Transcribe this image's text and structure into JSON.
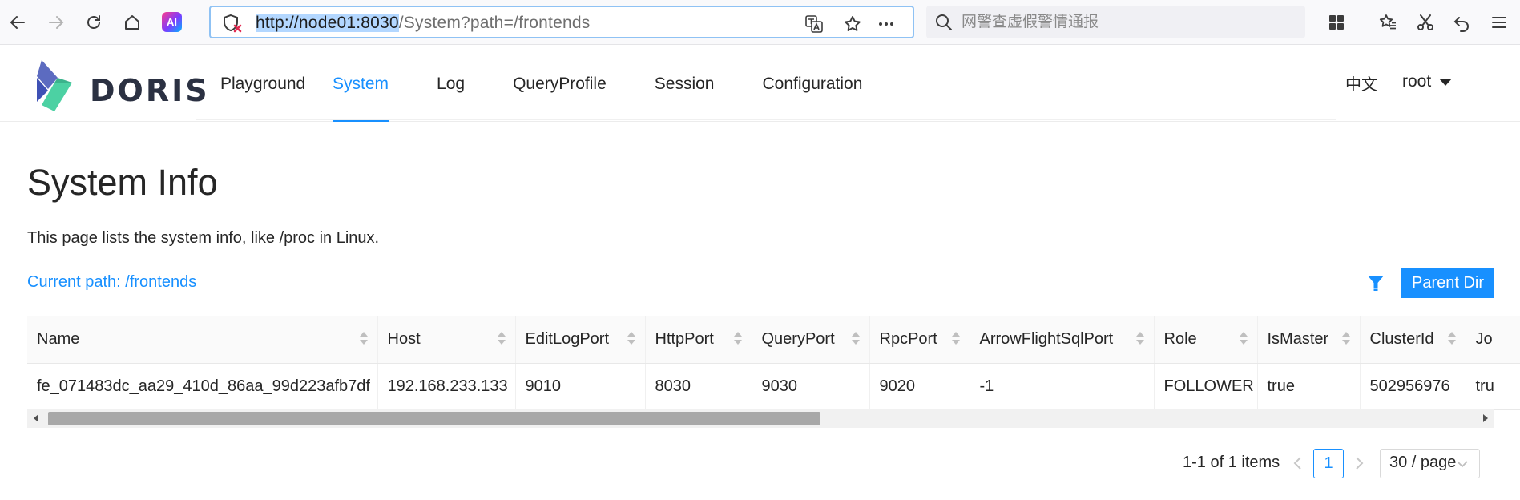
{
  "browser": {
    "url_host": "http://node01:8030",
    "url_path": "/System?path=/frontends",
    "search_placeholder": "网警查虚假警情通报",
    "ai_label": "AI"
  },
  "header": {
    "logo_text": "DORIS",
    "menu": [
      {
        "label": "Playground"
      },
      {
        "label": "System"
      },
      {
        "label": "Log"
      },
      {
        "label": "QueryProfile"
      },
      {
        "label": "Session"
      },
      {
        "label": "Configuration"
      }
    ],
    "active_menu": "System",
    "language": "中文",
    "user": "root"
  },
  "content": {
    "title": "System Info",
    "description": "This page lists the system info, like /proc in Linux.",
    "current_path": "Current path: /frontends",
    "parent_dir_label": "Parent Dir"
  },
  "table": {
    "columns": [
      "Name",
      "Host",
      "EditLogPort",
      "HttpPort",
      "QueryPort",
      "RpcPort",
      "ArrowFlightSqlPort",
      "Role",
      "IsMaster",
      "ClusterId",
      "Jo"
    ],
    "rows": [
      [
        "fe_071483dc_aa29_410d_86aa_99d223afb7df",
        "192.168.233.133",
        "9010",
        "8030",
        "9030",
        "9020",
        "-1",
        "FOLLOWER",
        "true",
        "502956976",
        "tru"
      ]
    ]
  },
  "pagination": {
    "total_text": "1-1 of 1 items",
    "current_page": "1",
    "page_size": "30 / page"
  },
  "colors": {
    "accent": "#1890ff",
    "text": "#262626"
  }
}
